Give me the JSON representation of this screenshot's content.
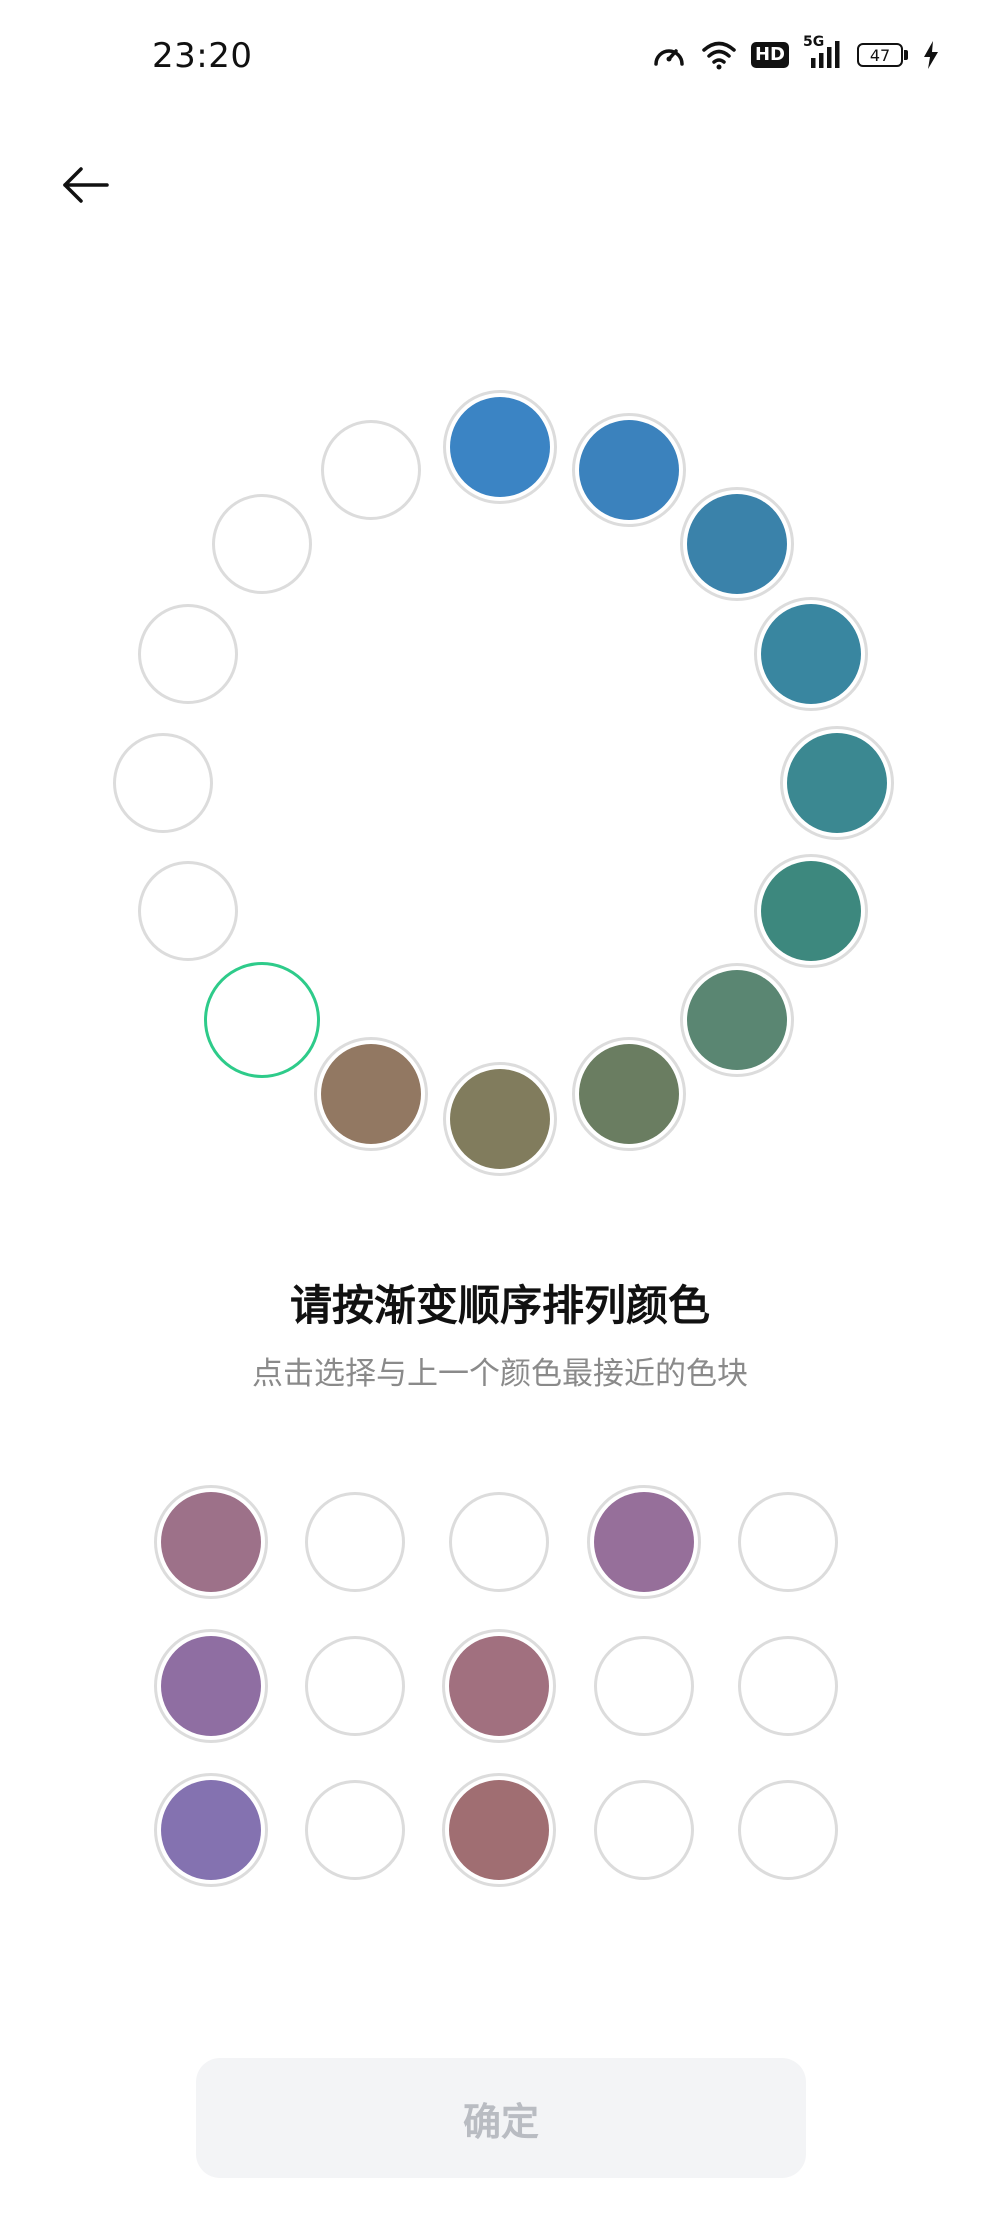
{
  "status_bar": {
    "time": "23:20",
    "icons": [
      "speed-icon",
      "wifi-icon",
      "hd-icon",
      "signal-5g-icon",
      "battery-icon",
      "charging-icon"
    ],
    "hd_label": "HD",
    "network_label": "5G",
    "battery_level": "47"
  },
  "header": {
    "back_icon": "arrow-left-icon"
  },
  "ring": {
    "colors": {
      "blue1": "#3b84c4",
      "blue2": "#3b82bd",
      "blue3": "#3a82aa",
      "teal1": "#3986a0",
      "teal2": "#3b8891",
      "teal3": "#3d887e",
      "green1": "#5a8672",
      "green2": "#6a7d61",
      "olive": "#817c5d",
      "brown": "#927862"
    }
  },
  "main": {
    "title": "请按渐变顺序排列颜色",
    "subtitle": "点击选择与上一个颜色最接近的色块"
  },
  "palette": {
    "colors": {
      "mauve1": "#9d7189",
      "violet1": "#966f9a",
      "violet2": "#8f6ea2",
      "rose1": "#a1707f",
      "indigo": "#8472b0",
      "rosebrown": "#a06e72"
    }
  },
  "footer": {
    "confirm_label": "确定"
  }
}
